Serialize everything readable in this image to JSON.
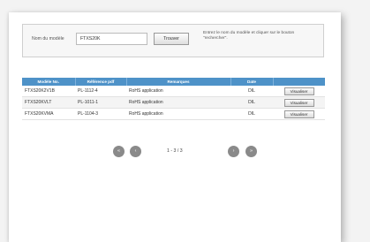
{
  "search": {
    "label": "Nom du modèle",
    "value": "FTXS20K",
    "button_label": "Trouver",
    "hint": "Entrez le nom du modèle et cliquer sur le bouton \"rechercher\"."
  },
  "table": {
    "headers": [
      "Modèle No.",
      "Référence pdf",
      "Remarques",
      "Date",
      ""
    ],
    "rows": [
      {
        "model": "FTXS20K2V1B",
        "ref": "PL-1112-4",
        "remark": "RoHS application",
        "date": "DIL",
        "action": "Visualiser"
      },
      {
        "model": "FTXS20KVLT",
        "ref": "PL-1011-1",
        "remark": "RoHS application",
        "date": "DIL",
        "action": "Visualiser"
      },
      {
        "model": "FTXS20KVMA",
        "ref": "PL-1104-3",
        "remark": "RoHS application",
        "date": "DIL",
        "action": "Visualiser"
      }
    ]
  },
  "pager": {
    "first_icon": "double-chevron-left-icon",
    "prev_icon": "chevron-left-icon",
    "page_text": "1 - 3 / 3",
    "next_icon": "chevron-right-icon",
    "last_icon": "double-chevron-right-icon",
    "glyphs": {
      "first": "«",
      "prev": "‹",
      "next": "›",
      "last": "»"
    },
    "button_color": "#8a8a8a"
  },
  "colors": {
    "header_bg": "#4e92c8",
    "header_text": "#ffffff"
  }
}
